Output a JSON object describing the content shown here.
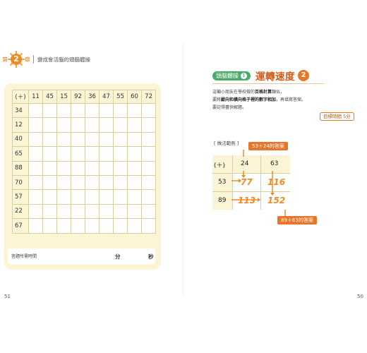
{
  "left_page": {
    "chapter": {
      "prefix": "第",
      "number": "2",
      "suffix": "章",
      "title": "變成會活腦的頭腦體操"
    },
    "worksheet": {
      "operator": "(＋)",
      "columns": [
        "11",
        "45",
        "15",
        "92",
        "36",
        "47",
        "55",
        "60",
        "72"
      ],
      "rows": [
        "34",
        "12",
        "40",
        "65",
        "88",
        "70",
        "57",
        "22",
        "67"
      ]
    },
    "time_box": {
      "label": "答題所需時間",
      "minutes_unit": "分",
      "seconds_unit": "秒"
    },
    "page_number": "51"
  },
  "right_page": {
    "section_label": "頭腦體操",
    "section_number": "1",
    "title": "運轉速度",
    "title_number": "2",
    "instructions": [
      "這顯小朋友在學校做的百格計算類似，",
      "要將縱向和橫向格子裡的數字相加，再填寫答案。",
      "要記得盡快解題。"
    ],
    "instruction_parts": {
      "line1_pre": "這顯小朋友在學校做的",
      "line1_bold": "百格計算",
      "line1_post": "類似，",
      "line2_pre": "要將",
      "line2_bold": "縱向和橫向格子裡的數字相加",
      "line2_post": "，再填寫答案。",
      "line3": "要記得盡快解題。"
    },
    "target_time": "目標時間 5分",
    "example": {
      "label": "[ 做法範例 ]",
      "operator": "(＋)",
      "columns": [
        "24",
        "63"
      ],
      "rows": [
        "53",
        "89"
      ],
      "answers": [
        [
          "77",
          "116"
        ],
        [
          "113",
          "152"
        ]
      ],
      "callout_top": "53＋24的答案",
      "callout_bottom": "89＋63的答案"
    },
    "page_number": "50"
  },
  "colors": {
    "accent_orange": "#e8762a",
    "panel_cream": "#fbf5d6",
    "pill_green": "#4aaa6a",
    "title_red": "#d25a14"
  }
}
